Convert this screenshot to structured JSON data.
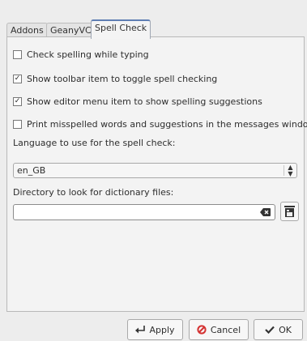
{
  "tabs": [
    {
      "label": "Addons"
    },
    {
      "label": "GeanyVC"
    },
    {
      "label": "Spell Check"
    }
  ],
  "active_tab": "Spell Check",
  "options": [
    {
      "label": "Check spelling while typing",
      "checked": false
    },
    {
      "label": "Show toolbar item to toggle spell checking",
      "checked": true
    },
    {
      "label": "Show editor menu item to show spelling suggestions",
      "checked": true
    },
    {
      "label": "Print misspelled words and suggestions in the messages window",
      "checked": false
    }
  ],
  "language": {
    "label": "Language to use for the spell check:",
    "value": "en_GB"
  },
  "directory": {
    "label": "Directory to look for dictionary files:",
    "value": ""
  },
  "buttons": {
    "apply": "Apply",
    "cancel": "Cancel",
    "ok": "OK"
  },
  "icons": {
    "apply": "apply-arrow-icon",
    "cancel": "cancel-icon",
    "ok": "checkmark-icon",
    "browse": "folder-icon",
    "clear": "clear-text-icon",
    "combo": "combo-arrows-icon"
  },
  "colors": {
    "cancel_icon": "#d43232",
    "active_tab_accent": "#5f7eb3"
  }
}
